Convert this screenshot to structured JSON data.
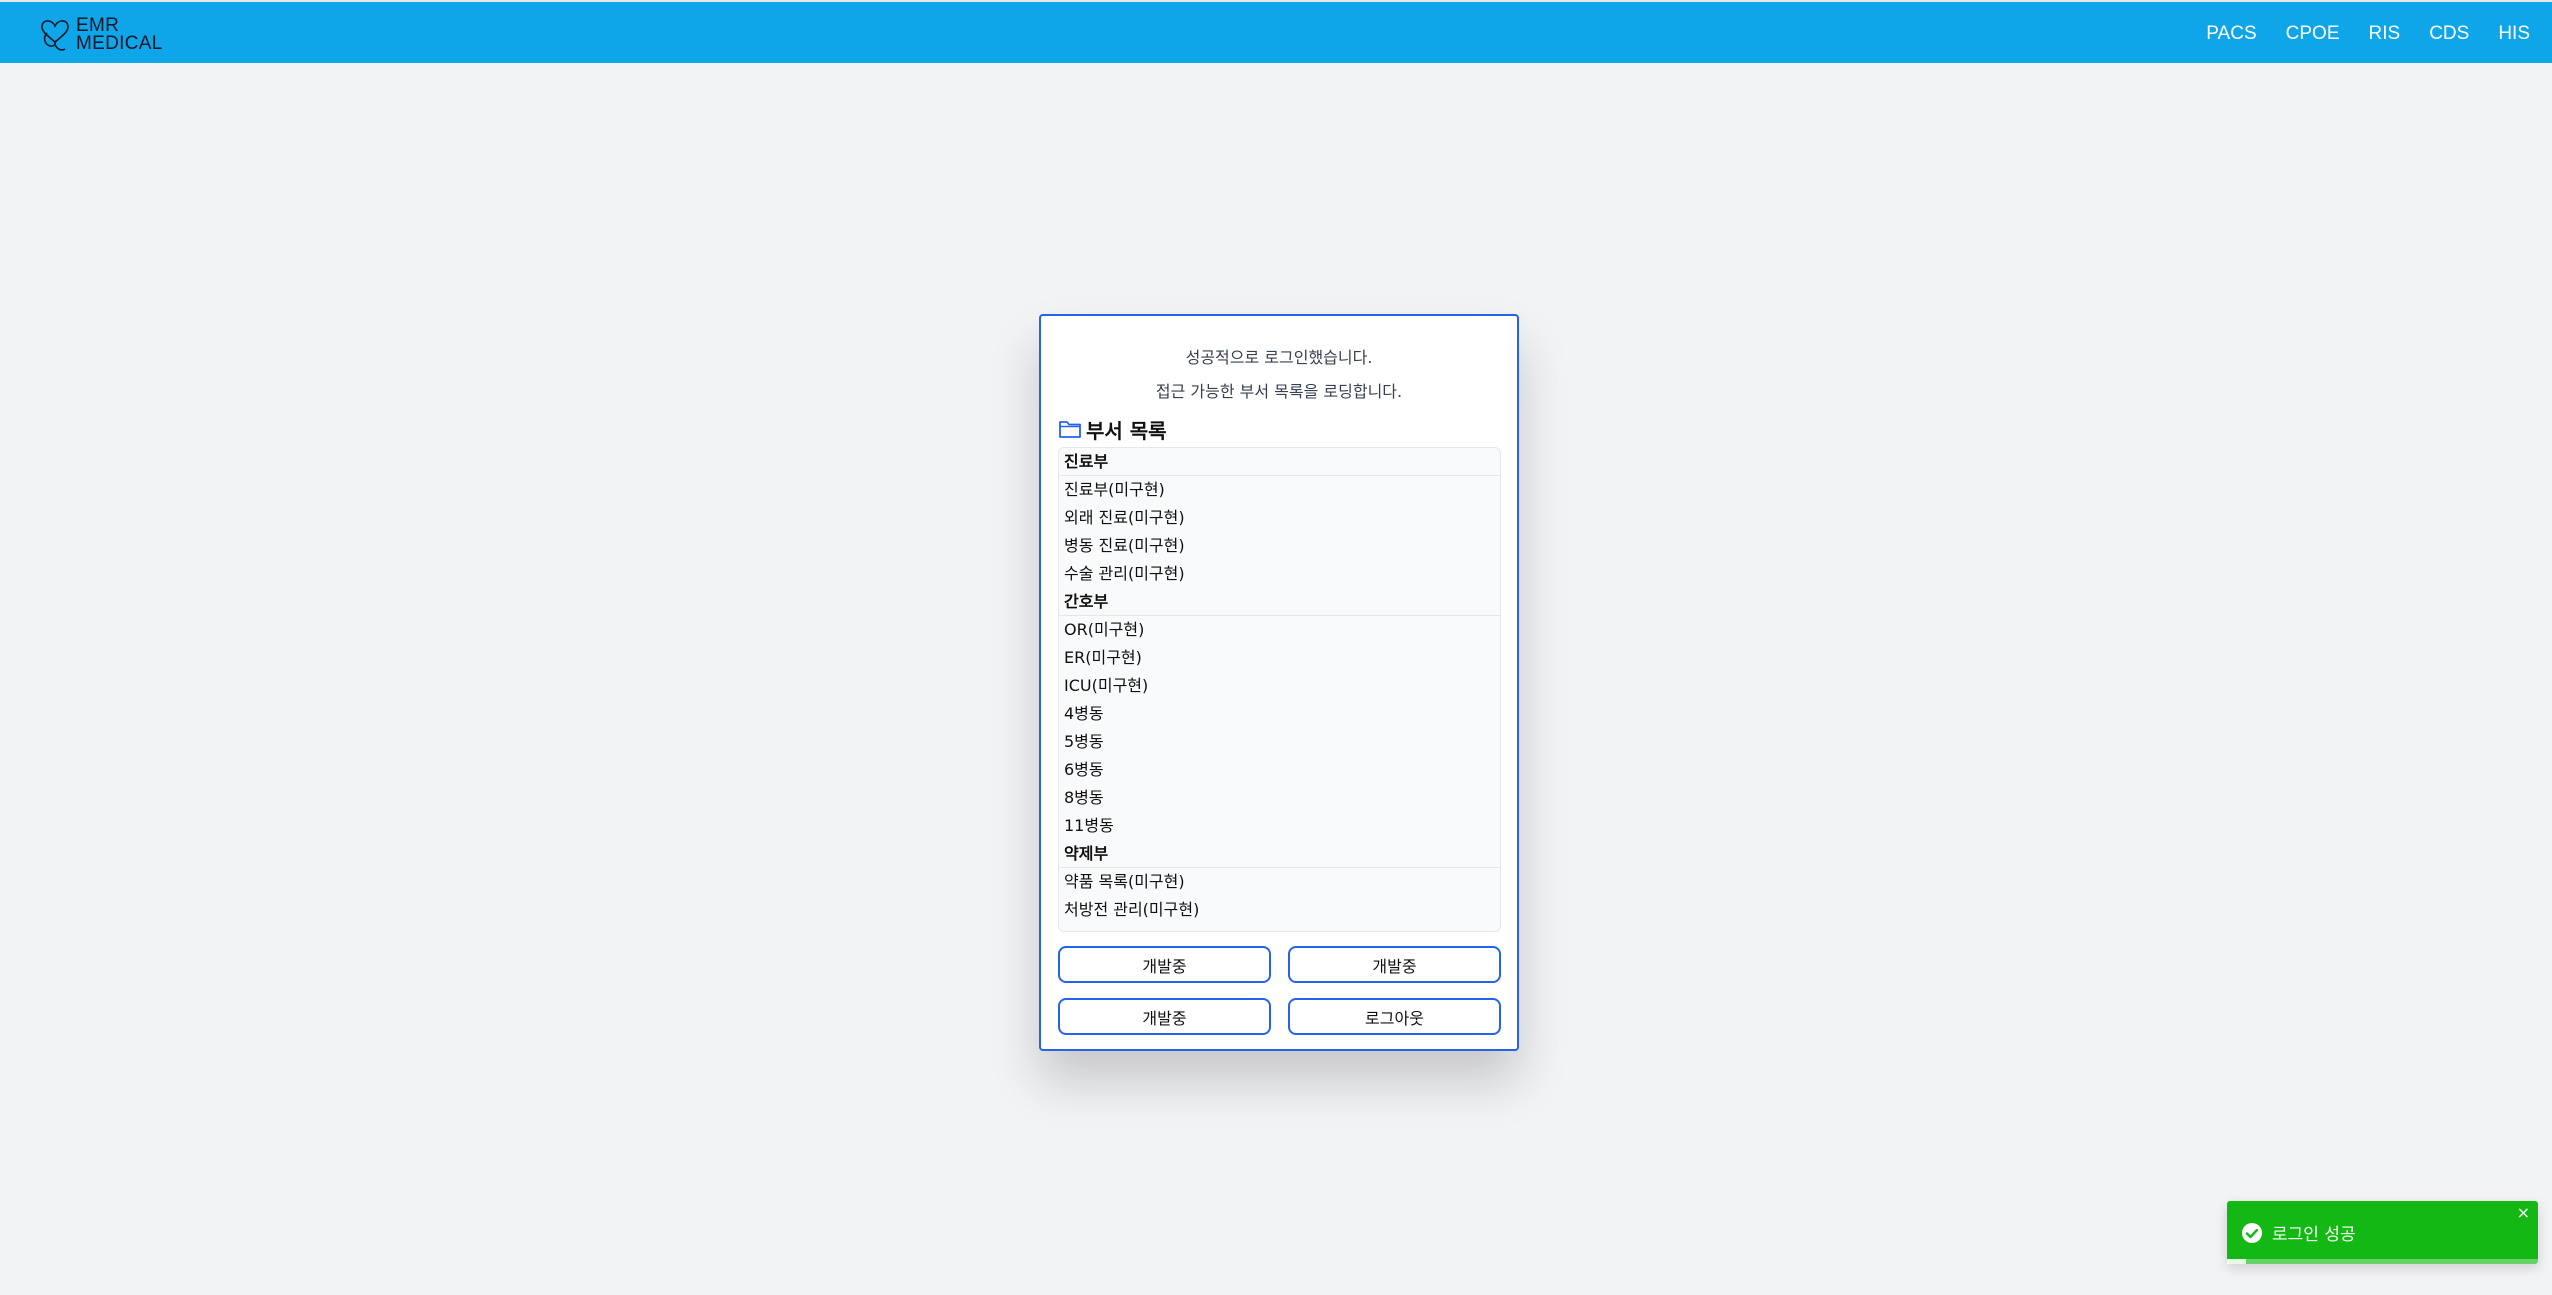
{
  "header": {
    "logo": {
      "line1": "EMR",
      "line2": "MEDICAL",
      "icon": "heart-logo-icon"
    },
    "nav": [
      "PACS",
      "CPOE",
      "RIS",
      "CDS",
      "HIS"
    ],
    "bg_color": "#0ea5e9"
  },
  "card": {
    "message_line1": "성공적으로 로그인했습니다.",
    "message_line2": "접근 가능한 부서 목록을 로딩합니다.",
    "list_title": "부서 목록",
    "list_icon": "folder-icon",
    "border_color": "#2563eb",
    "groups": [
      {
        "name": "진료부",
        "items": [
          "진료부(미구현)",
          "외래 진료(미구현)",
          "병동 진료(미구현)",
          "수술 관리(미구현)"
        ]
      },
      {
        "name": "간호부",
        "items": [
          "OR(미구현)",
          "ER(미구현)",
          "ICU(미구현)",
          "4병동",
          "5병동",
          "6병동",
          "8병동",
          "11병동"
        ]
      },
      {
        "name": "약제부",
        "items": [
          "약품 목록(미구현)",
          "처방전 관리(미구현)"
        ]
      }
    ],
    "buttons": [
      "개발중",
      "개발중",
      "개발중",
      "로그아웃"
    ]
  },
  "toast": {
    "message": "로그인 성공",
    "icon": "check-circle-icon",
    "close_icon": "close-icon",
    "close_label": "×",
    "color": "#14b814",
    "progress": 0.06
  }
}
